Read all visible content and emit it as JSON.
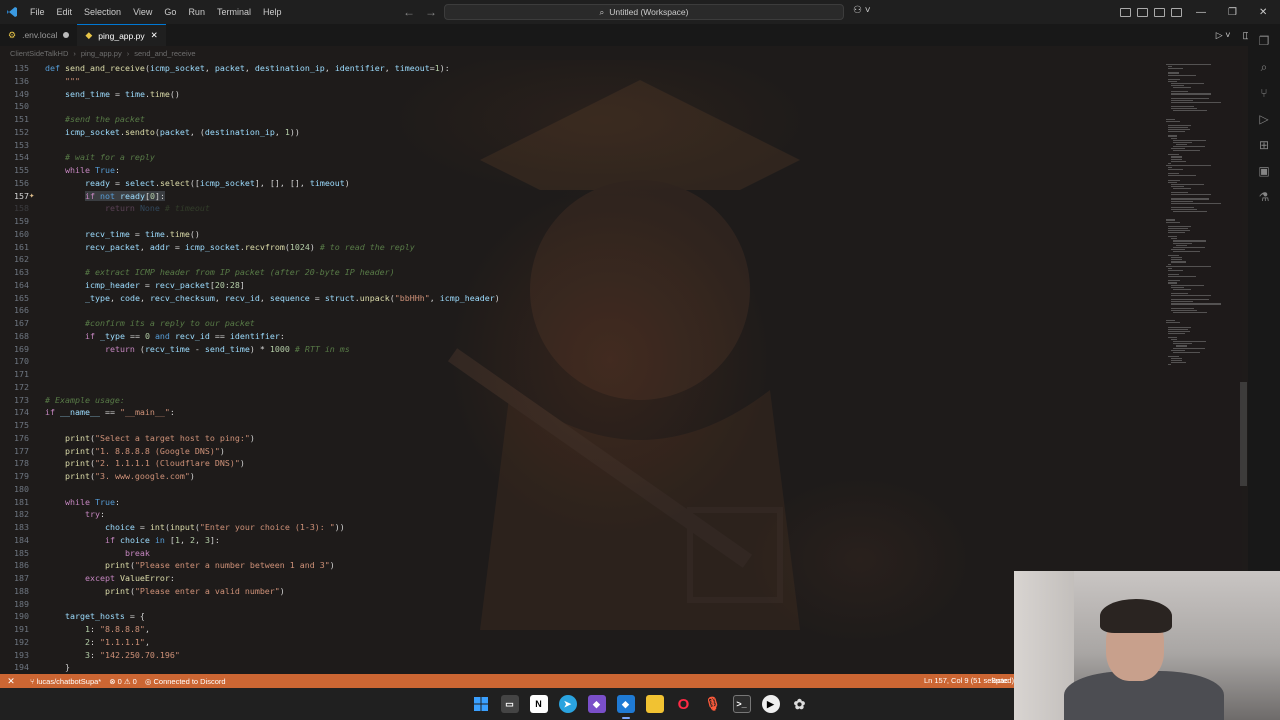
{
  "menu": [
    "File",
    "Edit",
    "Selection",
    "View",
    "Go",
    "Run",
    "Terminal",
    "Help"
  ],
  "command_center": "Untitled (Workspace)",
  "tabs": [
    {
      "label": ".env.local",
      "dirty": true
    },
    {
      "label": "ping_app.py",
      "active": true
    }
  ],
  "breadcrumb": [
    "ClientSideTalkHD",
    "ping_app.py",
    "send_and_receive"
  ],
  "code_lines": [
    {
      "n": "135",
      "html": "<span class='kwb'>def</span> <span class='fn'>send_and_receive</span>(<span class='var'>icmp_socket</span>, <span class='var'>packet</span>, <span class='var'>destination_ip</span>, <span class='var'>identifier</span>, <span class='var'>timeout</span>=<span class='num'>1</span>):"
    },
    {
      "n": "136",
      "html": "    <span class='str'>\"\"\"</span>"
    },
    {
      "n": "149",
      "html": "    <span class='var'>send_time</span> = <span class='var'>time</span>.<span class='fn'>time</span>()"
    },
    {
      "n": "150",
      "html": ""
    },
    {
      "n": "151",
      "html": "    <span class='com'>#send the packet</span>"
    },
    {
      "n": "152",
      "html": "    <span class='var'>icmp_socket</span>.<span class='fn'>sendto</span>(<span class='var'>packet</span>, (<span class='var'>destination_ip</span>, <span class='num'>1</span>))"
    },
    {
      "n": "153",
      "html": ""
    },
    {
      "n": "154",
      "html": "    <span class='com'># wait for a reply</span>"
    },
    {
      "n": "155",
      "html": "    <span class='kw'>while</span> <span class='kwb'>True</span>:"
    },
    {
      "n": "156",
      "html": "        <span class='var'>ready</span> = <span class='var'>select</span>.<span class='fn'>select</span>([<span class='var'>icmp_socket</span>], [], [], <span class='var'>timeout</span>)"
    },
    {
      "n": "157",
      "html": "        <span class='sel'><span class='kw'>if</span> <span class='kwb'>not</span> <span class='var'>ready</span>[<span class='num'>0</span>]:</span>",
      "current": true,
      "bulb": true
    },
    {
      "n": "158",
      "html": "            <span class='kw'>return</span> <span class='kwb'>None</span> <span class='com'># timeout</span>",
      "dim": true
    },
    {
      "n": "159",
      "html": ""
    },
    {
      "n": "160",
      "html": "        <span class='var'>recv_time</span> = <span class='var'>time</span>.<span class='fn'>time</span>()"
    },
    {
      "n": "161",
      "html": "        <span class='var'>recv_packet</span>, <span class='var'>addr</span> = <span class='var'>icmp_socket</span>.<span class='fn'>recvfrom</span>(<span class='num'>1024</span>) <span class='com'># to read the reply</span>"
    },
    {
      "n": "162",
      "html": ""
    },
    {
      "n": "163",
      "html": "        <span class='com'># extract ICMP header from IP packet (after 20-byte IP header)</span>"
    },
    {
      "n": "164",
      "html": "        <span class='var'>icmp_header</span> = <span class='var'>recv_packet</span>[<span class='num'>20</span>:<span class='num'>28</span>]"
    },
    {
      "n": "165",
      "html": "        <span class='var'>_type</span>, <span class='var'>code</span>, <span class='var'>recv_checksum</span>, <span class='var'>recv_id</span>, <span class='var'>sequence</span> = <span class='var'>struct</span>.<span class='fn'>unpack</span>(<span class='str'>\"bbHHh\"</span>, <span class='var'>icmp_header</span>)"
    },
    {
      "n": "166",
      "html": ""
    },
    {
      "n": "167",
      "html": "        <span class='com'>#confirm its a reply to our packet</span>"
    },
    {
      "n": "168",
      "html": "        <span class='kw'>if</span> <span class='var'>_type</span> == <span class='num'>0</span> <span class='kwb'>and</span> <span class='var'>recv_id</span> == <span class='var'>identifier</span>:"
    },
    {
      "n": "169",
      "html": "            <span class='kw'>return</span> (<span class='var'>recv_time</span> - <span class='var'>send_time</span>) * <span class='num'>1000</span> <span class='com'># RTT in ms</span>"
    },
    {
      "n": "170",
      "html": ""
    },
    {
      "n": "171",
      "html": ""
    },
    {
      "n": "172",
      "html": ""
    },
    {
      "n": "173",
      "html": "<span class='com'># Example usage:</span>"
    },
    {
      "n": "174",
      "html": "<span class='kw'>if</span> <span class='var'>__name__</span> == <span class='str'>\"__main__\"</span>:"
    },
    {
      "n": "175",
      "html": ""
    },
    {
      "n": "176",
      "html": "    <span class='fn'>print</span>(<span class='str'>\"Select a target host to ping:\"</span>)"
    },
    {
      "n": "177",
      "html": "    <span class='fn'>print</span>(<span class='str'>\"1. 8.8.8.8 (Google DNS)\"</span>)"
    },
    {
      "n": "178",
      "html": "    <span class='fn'>print</span>(<span class='str'>\"2. 1.1.1.1 (Cloudflare DNS)\"</span>)"
    },
    {
      "n": "179",
      "html": "    <span class='fn'>print</span>(<span class='str'>\"3. www.google.com\"</span>)"
    },
    {
      "n": "180",
      "html": ""
    },
    {
      "n": "181",
      "html": "    <span class='kw'>while</span> <span class='kwb'>True</span>:"
    },
    {
      "n": "182",
      "html": "        <span class='kw'>try</span>:"
    },
    {
      "n": "183",
      "html": "            <span class='var'>choice</span> = <span class='fn'>int</span>(<span class='fn'>input</span>(<span class='str'>\"Enter your choice (1-3): \"</span>))"
    },
    {
      "n": "184",
      "html": "            <span class='kw'>if</span> <span class='var'>choice</span> <span class='kwb'>in</span> [<span class='num'>1</span>, <span class='num'>2</span>, <span class='num'>3</span>]:"
    },
    {
      "n": "185",
      "html": "                <span class='kw'>break</span>"
    },
    {
      "n": "186",
      "html": "            <span class='fn'>print</span>(<span class='str'>\"Please enter a number between 1 and 3\"</span>)"
    },
    {
      "n": "187",
      "html": "        <span class='kw'>except</span> <span class='fn'>ValueError</span>:"
    },
    {
      "n": "188",
      "html": "            <span class='fn'>print</span>(<span class='str'>\"Please enter a valid number\"</span>)"
    },
    {
      "n": "189",
      "html": ""
    },
    {
      "n": "190",
      "html": "    <span class='var'>target_hosts</span> = {"
    },
    {
      "n": "191",
      "html": "        <span class='num'>1</span>: <span class='str'>\"8.8.8.8\"</span>,"
    },
    {
      "n": "192",
      "html": "        <span class='num'>2</span>: <span class='str'>\"1.1.1.1\"</span>,"
    },
    {
      "n": "193",
      "html": "        <span class='num'>3</span>: <span class='str'>\"142.250.70.196\"</span>"
    },
    {
      "n": "194",
      "html": "    }"
    }
  ],
  "status": {
    "branch": "lucas/chatbotSupa*",
    "problems": "⊗ 0 ⚠ 0",
    "discord": "Connected to Discord",
    "cursor": "Ln 157, Col 9 (51 selected)",
    "spaces": "Spac"
  },
  "taskbar_icons": [
    "start-icon",
    "taskview-icon",
    "notion-icon",
    "telegram-icon",
    "visual-studio-icon",
    "vscode-icon",
    "file-explorer-icon",
    "opera-icon",
    "microphone-icon",
    "terminal-icon",
    "media-player-icon",
    "chatgpt-icon"
  ],
  "accent_colors": {
    "status_bar": "#cc6633",
    "tab_border": "#0078d4"
  }
}
